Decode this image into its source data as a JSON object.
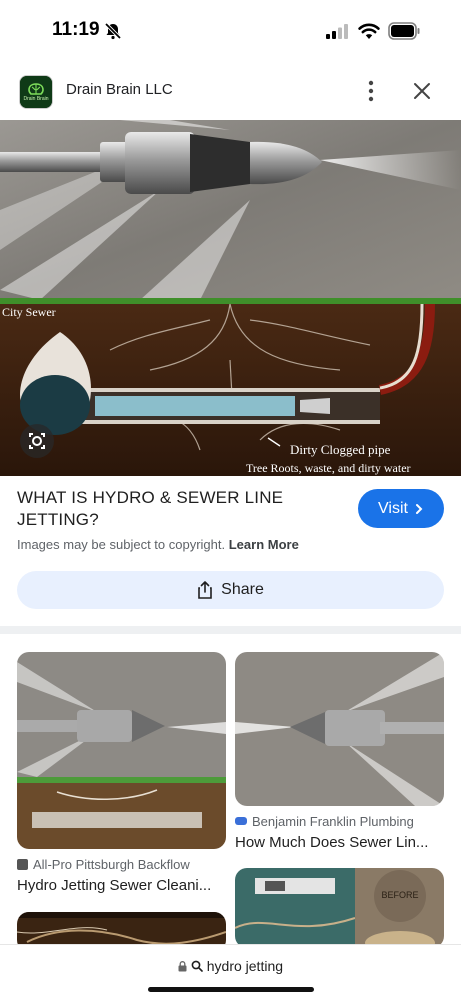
{
  "status_bar": {
    "time": "11:19"
  },
  "header": {
    "site_name": "Drain Brain LLC",
    "logo_text": "Drain Brain"
  },
  "hero": {
    "label_city_sewer": "City Sewer",
    "label_pipe": "Dirty Clogged pipe",
    "label_waste": "Tree Roots, waste, and dirty water"
  },
  "result": {
    "title": "WHAT IS HYDRO & SEWER LINE JETTING?",
    "visit_label": "Visit",
    "copyright_text": "Images may be subject to copyright.",
    "learn_more": "Learn More",
    "share_label": "Share"
  },
  "related": [
    {
      "source": "All-Pro Pittsburgh Backflow",
      "title": "Hydro Jetting Sewer Cleani..."
    },
    {
      "source": "Benjamin Franklin Plumbing",
      "title": "How Much Does Sewer Lin..."
    },
    {
      "image_text": "BEFORE"
    }
  ],
  "bottom_bar": {
    "query": "hydro jetting"
  }
}
